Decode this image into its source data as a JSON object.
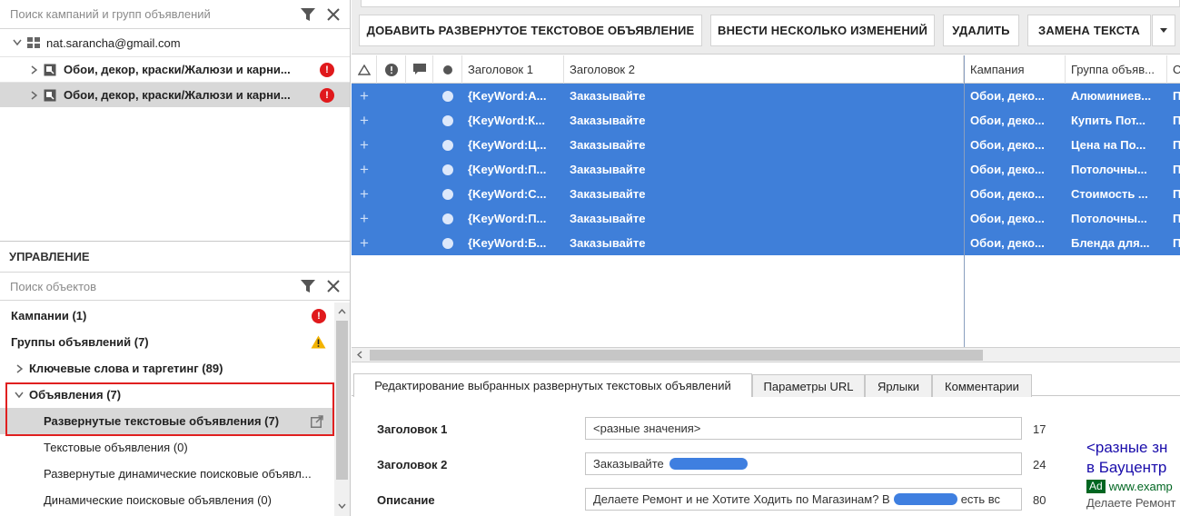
{
  "left": {
    "search_placeholder": "Поиск кампаний и групп объявлений",
    "account": "nat.sarancha@gmail.com",
    "campaigns": [
      {
        "label": "Обои, декор, краски/Жалюзи и карни..."
      },
      {
        "label": "Обои, декор, краски/Жалюзи и карни..."
      }
    ],
    "management": {
      "title": "УПРАВЛЕНИЕ",
      "search_placeholder": "Поиск объектов",
      "items": [
        {
          "label": "Кампании (1)"
        },
        {
          "label": "Группы объявлений (7)"
        },
        {
          "label": "Ключевые слова и таргетинг (89)"
        },
        {
          "label": "Объявления (7)"
        },
        {
          "label": "Развернутые текстовые объявления (7)"
        },
        {
          "label": "Текстовые объявления (0)"
        },
        {
          "label": "Развернутые динамические поисковые объявл..."
        },
        {
          "label": "Динамические поисковые объявления (0)"
        }
      ],
      "err_badge": "!"
    }
  },
  "toolbar": {
    "add_label": "ДОБАВИТЬ РАЗВЕРНУТОЕ ТЕКСТОВОЕ ОБЪЯВЛЕНИЕ",
    "multi_label": "ВНЕСТИ НЕСКОЛЬКО ИЗМЕНЕНИЙ",
    "delete_label": "УДАЛИТЬ",
    "replace_label": "ЗАМЕНА ТЕКСТА"
  },
  "grid": {
    "columns": {
      "h1": "Заголовок 1",
      "h2": "Заголовок 2",
      "campaign": "Кампания",
      "adgroup": "Группа объяв...",
      "extra": "С"
    },
    "rows": [
      {
        "h1": "{KeyWord:А...",
        "h2": "Заказывайте",
        "campaign": "Обои, деко...",
        "adgroup": "Алюминиев...",
        "extra": "П"
      },
      {
        "h1": "{KeyWord:К...",
        "h2": "Заказывайте",
        "campaign": "Обои, деко...",
        "adgroup": "Купить Пот...",
        "extra": "П"
      },
      {
        "h1": "{KeyWord:Ц...",
        "h2": "Заказывайте",
        "campaign": "Обои, деко...",
        "adgroup": "Цена на По...",
        "extra": "П"
      },
      {
        "h1": "{KeyWord:П...",
        "h2": "Заказывайте",
        "campaign": "Обои, деко...",
        "adgroup": "Потолочны...",
        "extra": "П"
      },
      {
        "h1": "{KeyWord:С...",
        "h2": "Заказывайте",
        "campaign": "Обои, деко...",
        "adgroup": "Стоимость ...",
        "extra": "П"
      },
      {
        "h1": "{KeyWord:П...",
        "h2": "Заказывайте",
        "campaign": "Обои, деко...",
        "adgroup": "Потолочны...",
        "extra": "П"
      },
      {
        "h1": "{KeyWord:Б...",
        "h2": "Заказывайте",
        "campaign": "Обои, деко...",
        "adgroup": "Бленда для...",
        "extra": "П"
      }
    ],
    "plus": "+"
  },
  "bottom": {
    "tabs": [
      "Редактирование выбранных развернутых текстовых объявлений",
      "Параметры URL",
      "Ярлыки",
      "Комментарии"
    ],
    "fields": {
      "h1_label": "Заголовок 1",
      "h1_value": "<разные значения>",
      "h1_count": "17",
      "h2_label": "Заголовок 2",
      "h2_value": "Заказывайте",
      "h2_count": "24",
      "desc_label": "Описание",
      "desc_value_a": "Делаете Ремонт и не Хотите Ходить по Магазинам? В",
      "desc_value_b": "есть вс",
      "desc_count": "80"
    },
    "preview": {
      "title_line1": "<разные зн",
      "title_line2": "в Бауцентр",
      "ad_badge": "Ad",
      "url": "www.examp",
      "desc": "Делаете Ремонт"
    }
  },
  "colors": {
    "selection": "#3f7fd9",
    "error": "#e0191c",
    "warning": "#f3b300",
    "highlight_box": "#e02020",
    "preview_link": "#1a0dab",
    "url_green": "#006621"
  }
}
